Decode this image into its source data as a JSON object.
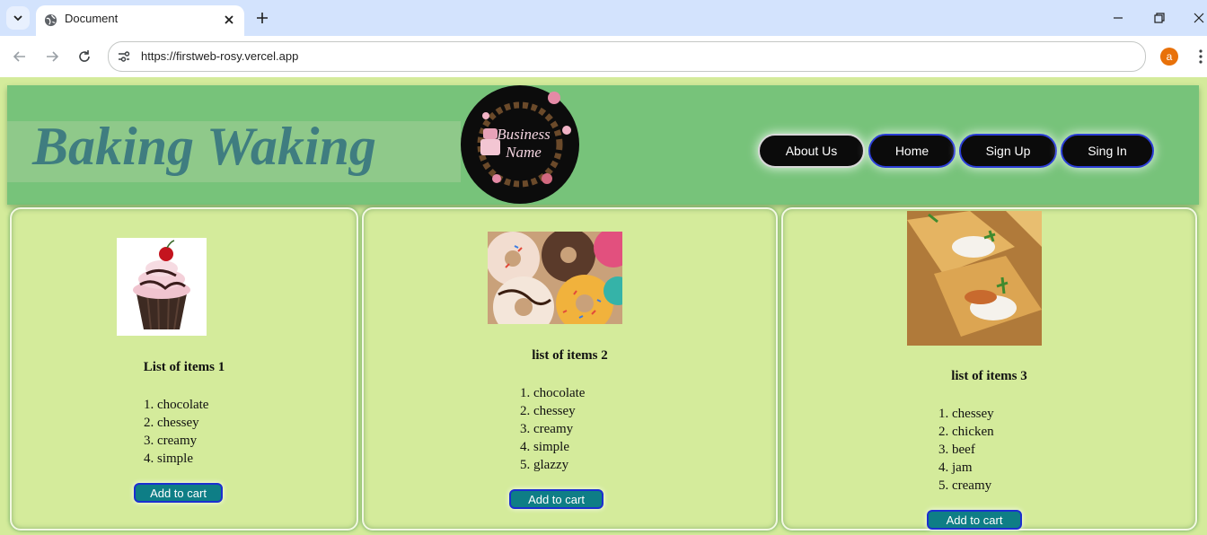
{
  "browser": {
    "tab_title": "Document",
    "url": "https://firstweb-rosy.vercel.app",
    "profile_initial": "a"
  },
  "header": {
    "brand": "Baking Waking",
    "logo_text": [
      "Business",
      "Name"
    ],
    "nav": [
      "About Us",
      "Home",
      "Sign Up",
      "Sing In"
    ]
  },
  "cards": [
    {
      "heading": "List of items 1",
      "items": [
        "chocolate",
        "chessey",
        "creamy",
        "simple"
      ],
      "button": "Add to cart",
      "image": "cupcake"
    },
    {
      "heading": "list of items 2",
      "items": [
        "chocolate",
        "chessey",
        "creamy",
        "simple",
        "glazzy"
      ],
      "button": "Add to cart",
      "image": "donuts"
    },
    {
      "heading": "list of items 3",
      "items": [
        "chessey",
        "chicken",
        "beef",
        "jam",
        "creamy"
      ],
      "button": "Add to cart",
      "image": "pastries"
    }
  ],
  "colors": {
    "page_bg": "#d4eb9b",
    "header_bg": "#77c37a",
    "brand_text": "#3f7d80",
    "nav_bg": "#0b0b0b",
    "button_bg": "#0e7e86",
    "button_border": "#1b2fd0"
  }
}
